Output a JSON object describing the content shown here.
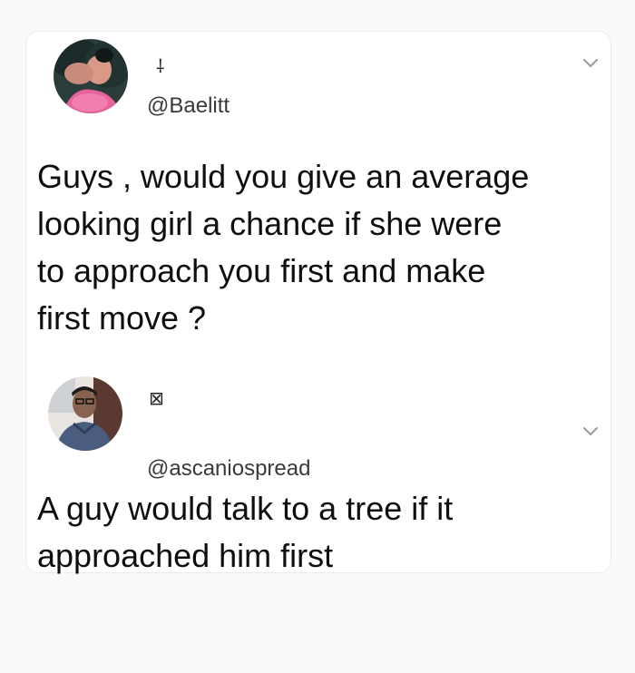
{
  "tweets": [
    {
      "display_name_glyph": "⸸",
      "handle": "@Baelitt",
      "avatar": "profile-photo-woman-icon",
      "menu_icon": "chevron-down-icon",
      "text": "Guys , would you give an average\nlooking girl a chance if she were\nto approach you first and make\nfirst move ?"
    },
    {
      "display_name_glyph": "⊠",
      "handle": "@ascaniospread",
      "avatar": "profile-photo-man-icon",
      "menu_icon": "chevron-down-icon",
      "text": "A guy would talk to a tree if it\napproached him first"
    }
  ],
  "colors": {
    "background": "#fafafa",
    "card": "#ffffff",
    "text": "#0f0f0f",
    "handle": "#3a3a3a",
    "chevron": "#9a9a9a"
  }
}
